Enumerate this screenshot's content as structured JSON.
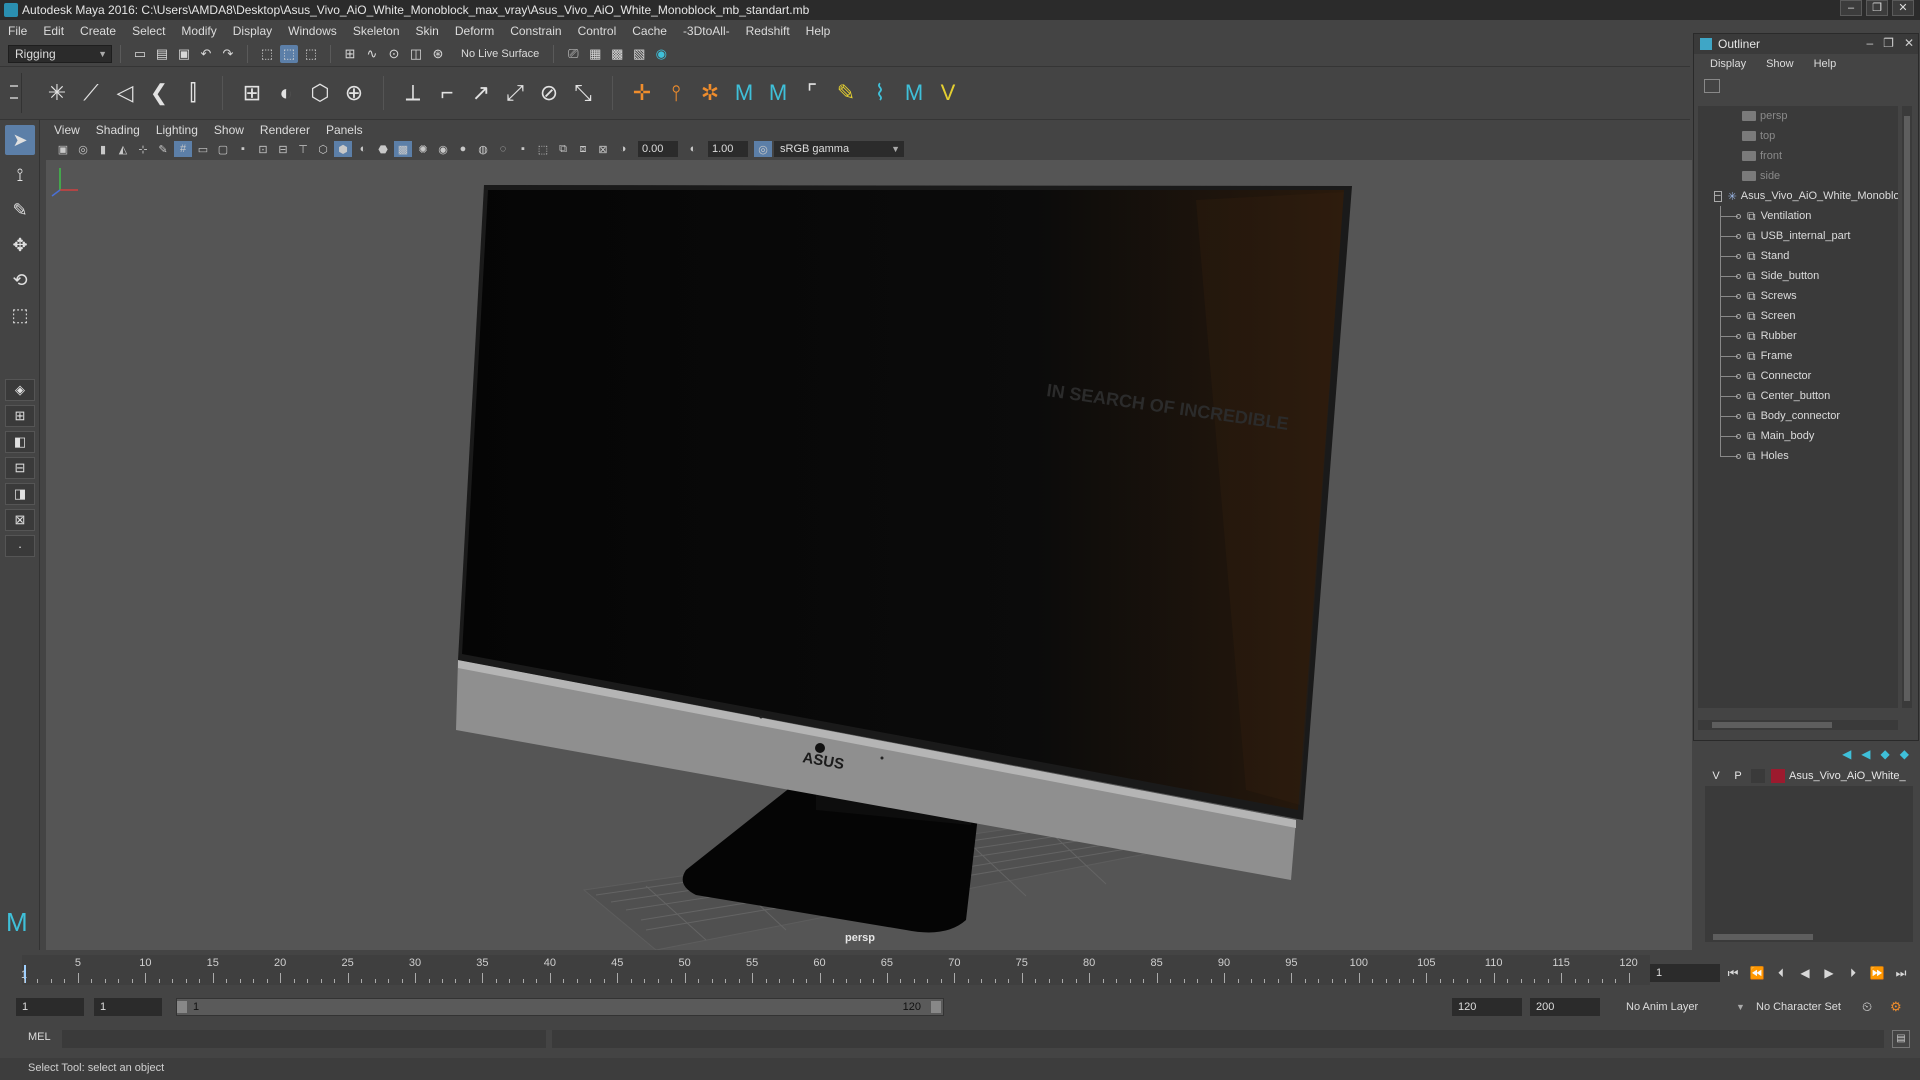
{
  "window": {
    "title": "Autodesk Maya 2016: C:\\Users\\AMDA8\\Desktop\\Asus_Vivo_AiO_White_Monoblock_max_vray\\Asus_Vivo_AiO_White_Monoblock_mb_standart.mb"
  },
  "menubar": {
    "items": [
      "File",
      "Edit",
      "Create",
      "Select",
      "Modify",
      "Display",
      "Windows",
      "Skeleton",
      "Skin",
      "Deform",
      "Constrain",
      "Control",
      "Cache",
      "-3DtoAll-",
      "Redshift",
      "Help"
    ]
  },
  "statusline": {
    "menu_set": "Rigging",
    "live_surface": "No Live Surface"
  },
  "viewport": {
    "menus": [
      "View",
      "Shading",
      "Lighting",
      "Show",
      "Renderer",
      "Panels"
    ],
    "exposure": "0.00",
    "gamma": "1.00",
    "color_space": "sRGB gamma",
    "camera_label": "persp",
    "model_logo": "ASUS",
    "screen_reflection_text": "IN SEARCH OF INCREDIBLE"
  },
  "outliner": {
    "title": "Outliner",
    "menus": [
      "Display",
      "Show",
      "Help"
    ],
    "cameras": [
      "persp",
      "top",
      "front",
      "side"
    ],
    "root": "Asus_Vivo_AiO_White_Monoblock",
    "children": [
      "Ventilation",
      "USB_internal_part",
      "Stand",
      "Side_button",
      "Screws",
      "Screen",
      "Rubber",
      "Frame",
      "Connector",
      "Center_button",
      "Body_connector",
      "Main_body",
      "Holes"
    ]
  },
  "layer_editor": {
    "layer": {
      "v": "V",
      "p": "P",
      "name": "Asus_Vivo_AiO_White_",
      "color": "#9c1a2e"
    }
  },
  "timeslider": {
    "tick_labels": [
      "5",
      "10",
      "15",
      "20",
      "25",
      "30",
      "35",
      "40",
      "45",
      "50",
      "55",
      "60",
      "65",
      "70",
      "75",
      "80",
      "85",
      "90",
      "95",
      "100",
      "105",
      "110",
      "115",
      "120"
    ],
    "start_marker": "1",
    "current_frame": "1"
  },
  "rangeslider": {
    "start": "1",
    "playback_start": "1",
    "range_low": "1",
    "range_high": "120",
    "playback_end": "120",
    "end": "200",
    "anim_layer": "No Anim Layer",
    "character_set": "No Character Set"
  },
  "cmdline": {
    "label": "MEL"
  },
  "helpline": {
    "text": "Select Tool: select an object"
  }
}
